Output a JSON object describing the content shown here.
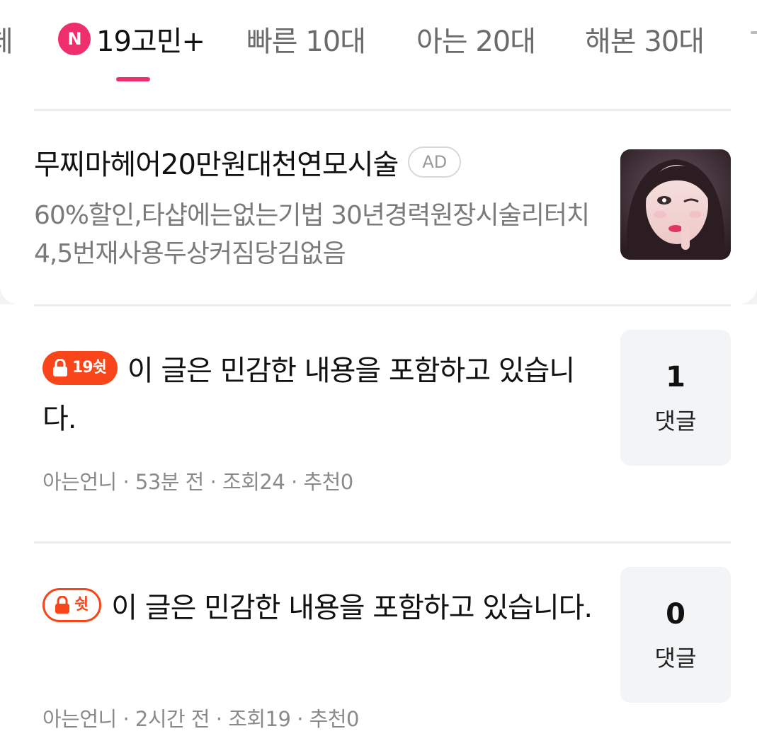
{
  "tabs": {
    "cut_left": "체",
    "active": {
      "badge": "N",
      "label": "19고민+"
    },
    "items": [
      "빠른 10대",
      "아는 20대",
      "해본 30대"
    ]
  },
  "ad": {
    "title": "무찌마헤어20만원대천연모시술",
    "badge": "AD",
    "description": "60%할인,타샵에는없는기법 30년경력원장시술리터치4,5번재사용두상커짐당김없음",
    "thumbnail_icon": "woman-portrait-photo"
  },
  "posts": [
    {
      "tag": "19쉿",
      "tag_style": "filled",
      "title": "이 글은 민감한 내용을 포함하고 있습니다.",
      "meta": "아는언니 · 53분 전 · 조회24 · 추천0",
      "comment_count": "1",
      "comment_label": "댓글"
    },
    {
      "tag": "쉿",
      "tag_style": "outline",
      "title": "이 글은 민감한 내용을 포함하고 있습니다.",
      "meta": "아는언니 · 2시간 전 · 조회19 · 추천0",
      "comment_count": "0",
      "comment_label": "댓글"
    }
  ],
  "colors": {
    "accent": "#ee2f6c",
    "tag": "#f8461a",
    "muted_text": "#8a8a8a"
  }
}
